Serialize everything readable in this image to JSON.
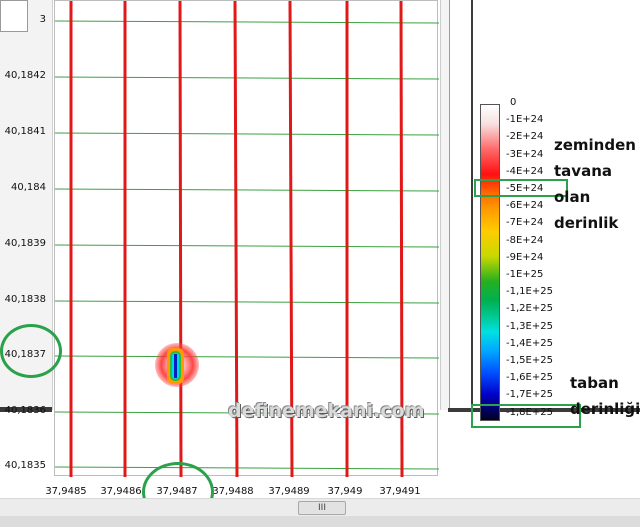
{
  "y_axis": {
    "top_partial": "3",
    "ticks": [
      "40,1842",
      "40,1841",
      "40,184",
      "40,1839",
      "40,1838",
      "40,1837",
      "40,1836",
      "40,1835"
    ]
  },
  "x_axis": {
    "ticks": [
      "37,9485",
      "37,9486",
      "37,9487",
      "37,9488",
      "37,9489",
      "37,949",
      "37,9491"
    ]
  },
  "colorbar": {
    "labels": [
      "0",
      "-1E+24",
      "-2E+24",
      "-3E+24",
      "-4E+24",
      "-5E+24",
      "-6E+24",
      "-7E+24",
      "-8E+24",
      "-9E+24",
      "-1E+25",
      "-1,1E+25",
      "-1,2E+25",
      "-1,3E+25",
      "-1,4E+25",
      "-1,5E+25",
      "-1,6E+25",
      "-1,7E+25",
      "-1,8E+25"
    ]
  },
  "annotations": {
    "top_lines": [
      "zeminden",
      "tavana",
      "olan",
      "derinlik"
    ],
    "bottom_lines": [
      "taban",
      "derinliği"
    ]
  },
  "watermark": "definemekani.com",
  "scrollbar": {
    "thumb_label": "III"
  },
  "colors": {
    "grid_line": "#3aa040",
    "survey_line": "#e01818",
    "highlight": "#2aa14a"
  }
}
